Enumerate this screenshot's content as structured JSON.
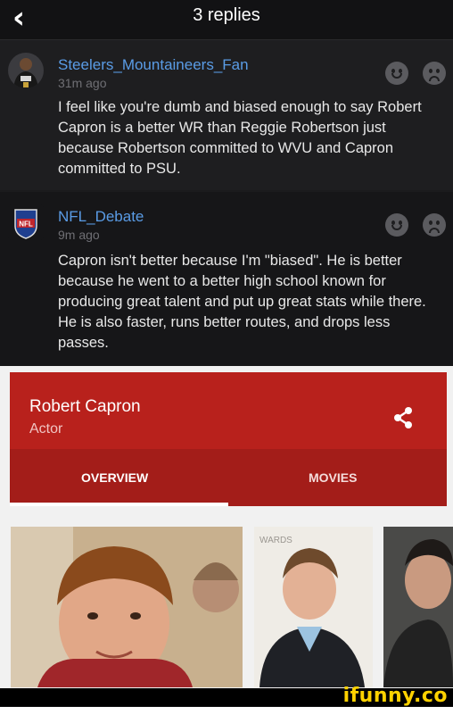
{
  "header": {
    "title": "3 replies"
  },
  "comments": [
    {
      "username": "Steelers_Mountaineers_Fan",
      "time": "31m ago",
      "text": "I feel like you're dumb and biased enough to say Robert Capron is a better WR than Reggie Robertson just because Robertson committed to WVU and Capron committed to PSU."
    },
    {
      "username": "NFL_Debate",
      "time": "9m ago",
      "text": "Capron isn't better because I'm \"biased\". He is better because he went to a better high school known for producing great talent and put up great stats while there. He is also faster, runs better routes, and drops less passes.",
      "avatar_text": "NFL"
    }
  ],
  "knowledge_card": {
    "name": "Robert Capron",
    "subtitle": "Actor",
    "tabs": [
      "OVERVIEW",
      "MOVIES"
    ],
    "photo_caption": "WARDS"
  },
  "footer": {
    "brand": "ifunny.co"
  },
  "colors": {
    "username": "#5a9ce6",
    "card_red": "#b8211c",
    "brand_yellow": "#ffd200"
  }
}
